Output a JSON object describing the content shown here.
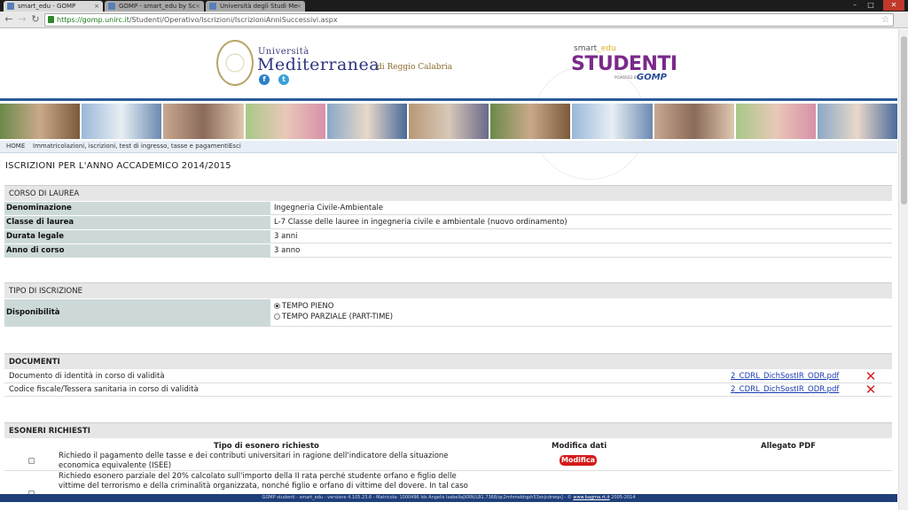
{
  "browser": {
    "tabs": [
      {
        "title": "smart_edu - GOMP",
        "active": true
      },
      {
        "title": "GOMP - smart_edu by Sc",
        "active": false
      },
      {
        "title": "Università degli Studi Me",
        "active": false
      }
    ],
    "url_host": "https://gomp.unirc.it",
    "url_path": "/Studenti/Operativo/Iscrizioni/IscrizioniAnniSuccessivi.aspx",
    "back_icon": "arrow-left-icon",
    "forward_icon": "arrow-right-icon",
    "reload_icon": "reload-icon",
    "star_icon": "star-icon"
  },
  "header": {
    "univ_small": "Università",
    "univ_big": "Mediterranea",
    "univ_loc": "di Reggio Calabria",
    "smart_prefix": "smart",
    "smart_suffix": "_edu",
    "studenti": "STUDENTI",
    "powered_by": "POWERED BY",
    "gomp": "GOMP",
    "social": [
      {
        "name": "facebook-icon",
        "glyph": "f"
      },
      {
        "name": "twitter-icon",
        "glyph": "t"
      }
    ]
  },
  "nav": {
    "home": "HOME",
    "immatricolazioni": "Immatricolazioni, iscrizioni, test di ingresso, tasse e pagamenti",
    "esci": "Esci"
  },
  "page_title": "ISCRIZIONI PER L'ANNO ACCADEMICO 2014/2015",
  "corso": {
    "heading": "CORSO DI LAUREA",
    "rows": [
      {
        "label": "Denominazione",
        "value": "Ingegneria Civile-Ambientale"
      },
      {
        "label": "Classe di laurea",
        "value": "L-7 Classe delle lauree in ingegneria civile e ambientale (nuovo ordinamento)"
      },
      {
        "label": "Durata legale",
        "value": "3 anni"
      },
      {
        "label": "Anno di corso",
        "value": "3 anno"
      }
    ]
  },
  "tipo": {
    "heading": "TIPO DI ISCRIZIONE",
    "label": "Disponibilità",
    "options": [
      {
        "label": "TEMPO PIENO",
        "selected": true
      },
      {
        "label": "TEMPO PARZIALE (PART-TIME)",
        "selected": false
      }
    ]
  },
  "documenti": {
    "heading": "DOCUMENTI",
    "rows": [
      {
        "label": "Documento di identità in corso di validità",
        "file": "2_CDRL_DichSostIR_ODR.pdf"
      },
      {
        "label": "Codice fiscale/Tessera sanitaria in corso di validità",
        "file": "2_CDRL_DichSostIR_ODR.pdf"
      }
    ],
    "delete_icon": "delete-x-icon"
  },
  "esoneri": {
    "heading": "ESONERI RICHIESTI",
    "col_tipo": "Tipo di esonero richiesto",
    "col_modifica": "Modifica dati",
    "col_allegato": "Allegato PDF",
    "rows": [
      {
        "text": "Richiedo il pagamento delle tasse e dei contributi universitari in ragione dell'indicatore della situazione economica equivalente (ISEE)",
        "button": "Modifica"
      },
      {
        "text": "Richiedo esonero parziale del 20% calcolato sull'importo della II rata perché studente orfano e figlio delle vittime del terrorismo e della criminalità organizzata, nonché figlio e orfano di vittime del dovere. In tal caso"
      }
    ]
  },
  "footer": {
    "text": "GOMP studenti - smart_edu - versione 4.105.23.6 - Matricola: 1000496 Ids Angelis Isabella[KRN/LB1.7368/qc2mhmebtqph53snjcdrwqs] - ©",
    "link": "www.bagma.rt.it",
    "years": "2005-2014"
  }
}
